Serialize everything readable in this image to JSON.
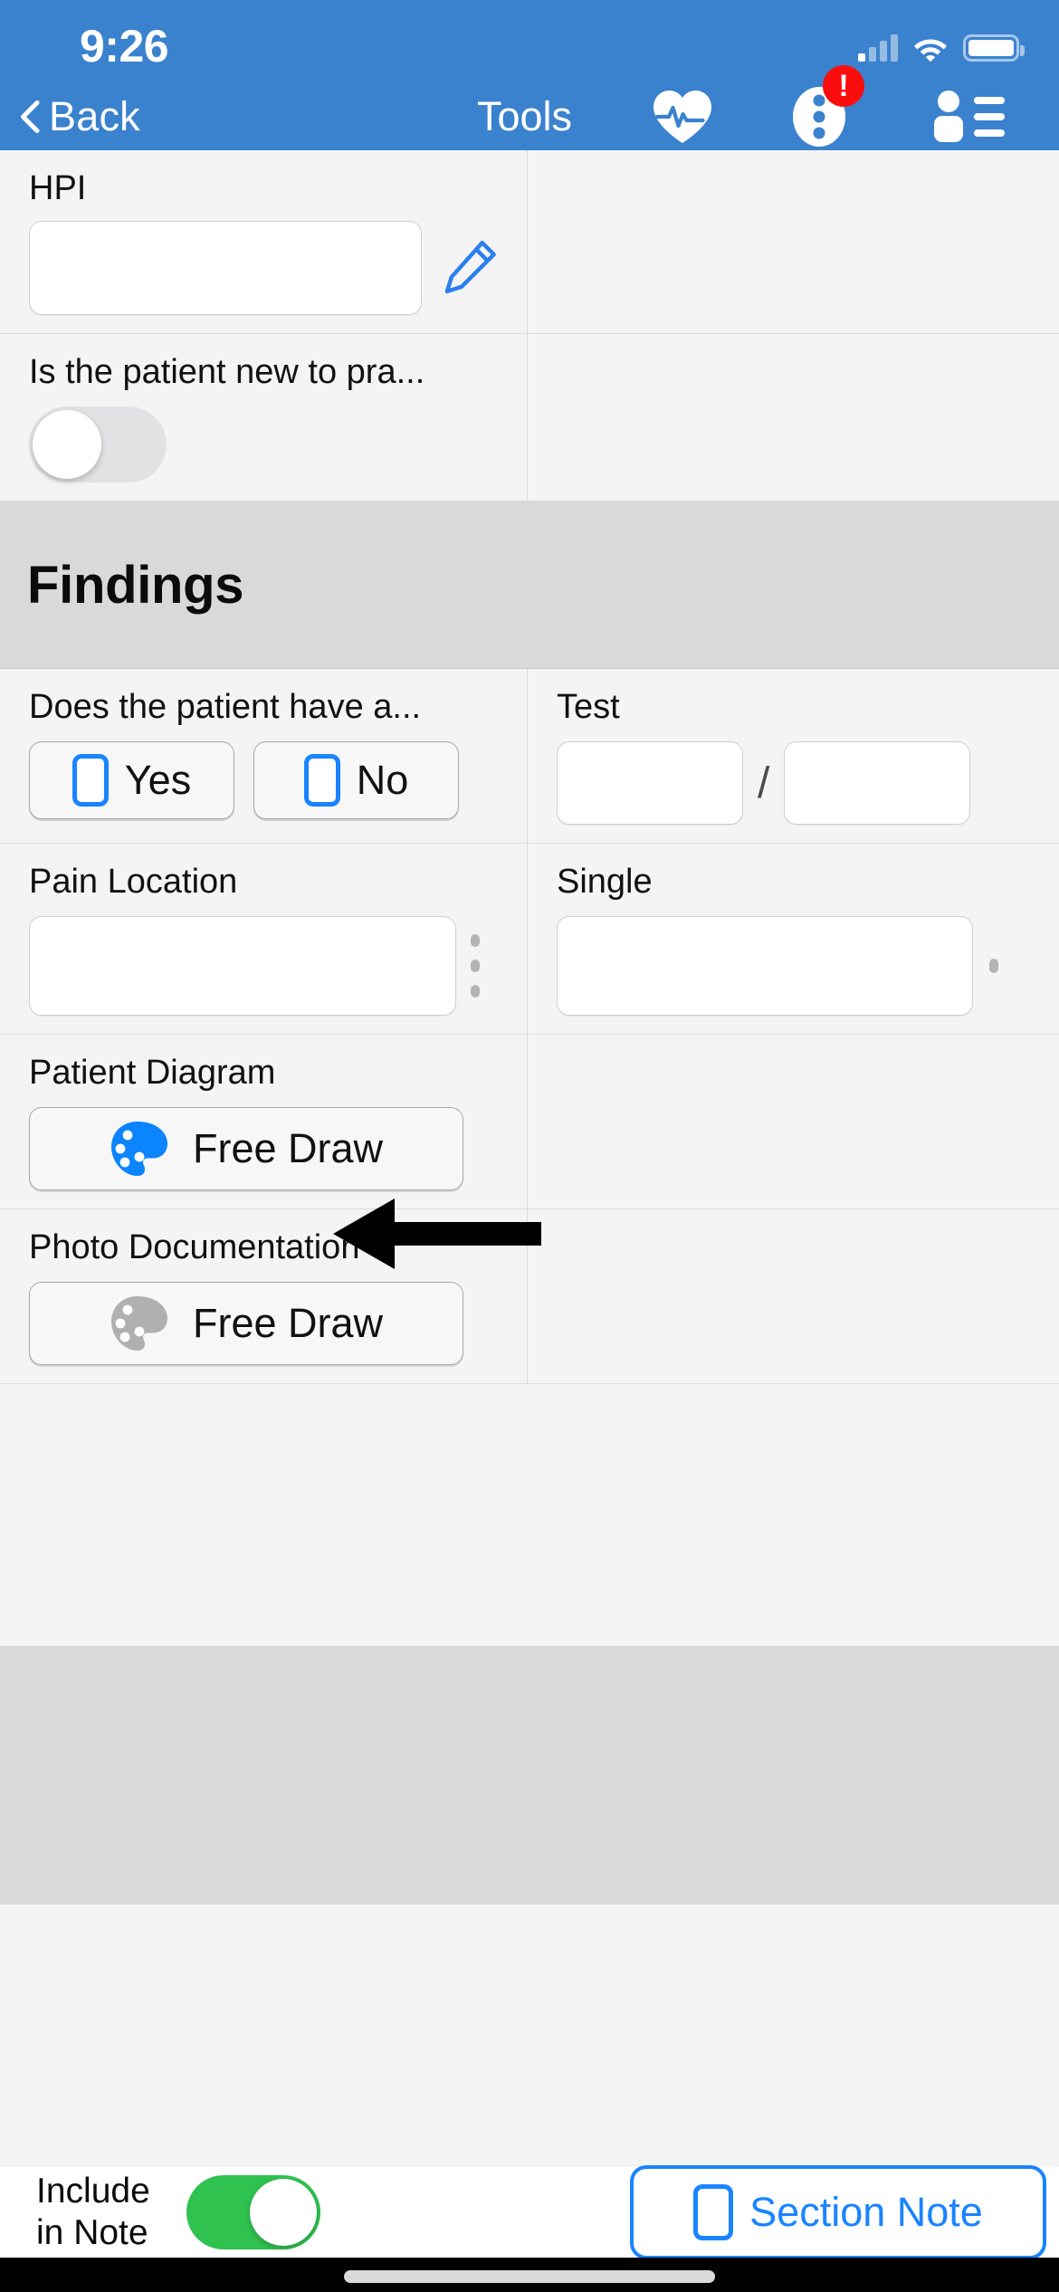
{
  "status_bar": {
    "time": "9:26",
    "signal_icon": "cellular-signal-icon",
    "wifi_icon": "wifi-icon",
    "battery_icon": "battery-icon"
  },
  "nav_bar": {
    "back_label": "Back",
    "back_icon": "chevron-left-icon",
    "title": "Tools",
    "vitals_icon": "heart-pulse-icon",
    "more_icon": "more-vertical-icon",
    "more_badge": "!",
    "patient_icon": "patient-list-icon",
    "background_color": "#3b82ce"
  },
  "form": {
    "hpi": {
      "label": "HPI",
      "value": "",
      "placeholder": "",
      "edit_icon": "pencil-icon"
    },
    "patient_new": {
      "label": "Is the patient new to pra...",
      "toggle_state": "off"
    },
    "section_title": "Findings",
    "has_condition": {
      "label": "Does the patient have a...",
      "options": [
        {
          "label": "Yes",
          "checked": false
        },
        {
          "label": "No",
          "checked": false
        }
      ]
    },
    "test": {
      "label": "Test",
      "value_numerator": "",
      "value_denominator": "",
      "separator": "/"
    },
    "pain_location": {
      "label": "Pain Location",
      "value": "",
      "menu_icon": "vertical-dots-icon"
    },
    "single": {
      "label": "Single",
      "value": "",
      "menu_icon": "dot-icon"
    },
    "patient_diagram": {
      "label": "Patient Diagram",
      "button_label": "Free Draw",
      "button_icon": "palette-icon",
      "icon_color": "#0b84fe"
    },
    "photo_documentation": {
      "label": "Photo Documentation",
      "button_label": "Free Draw",
      "button_icon": "palette-icon",
      "icon_color": "#b0b0b0"
    }
  },
  "annotation": {
    "arrow_icon": "left-arrow-annotation",
    "color": "#000000"
  },
  "bottom_bar": {
    "include_label_line1": "Include",
    "include_label_line2": "in Note",
    "include_toggle_state": "on",
    "include_toggle_color": "#2fc24f",
    "section_note_label": "Section Note",
    "section_note_checked": false,
    "accent_color": "#1a84ff"
  },
  "home_indicator": {
    "icon": "home-indicator"
  }
}
